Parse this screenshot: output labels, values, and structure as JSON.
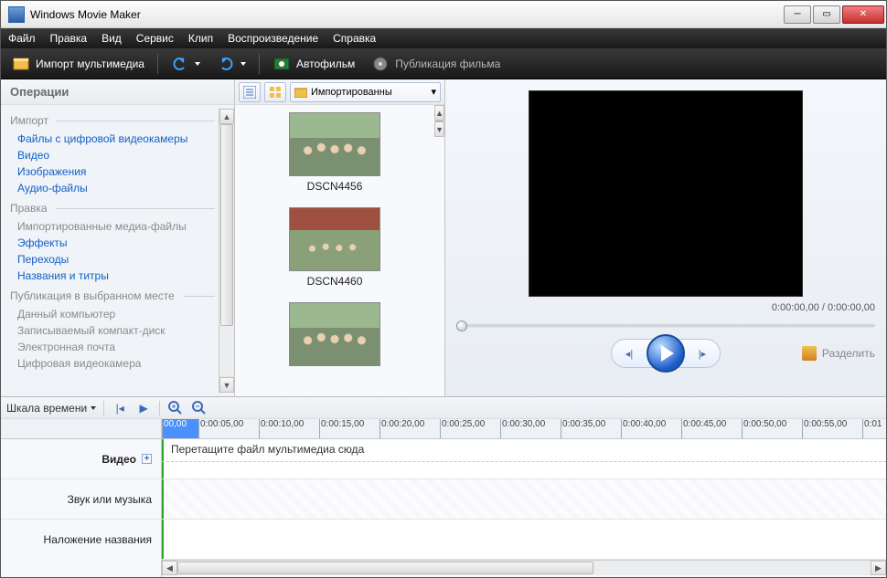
{
  "titlebar": {
    "title": "Windows Movie Maker"
  },
  "menubar": [
    "Файл",
    "Правка",
    "Вид",
    "Сервис",
    "Клип",
    "Воспроизведение",
    "Справка"
  ],
  "toolbar": {
    "import": "Импорт мультимедиа",
    "automovie": "Автофильм",
    "publish": "Публикация фильма"
  },
  "tasks": {
    "header": "Операции",
    "groups": [
      {
        "title": "Импорт",
        "cls": "mid",
        "items": [
          {
            "label": "Файлы с цифровой видеокамеры",
            "enabled": true
          },
          {
            "label": "Видео",
            "enabled": true
          },
          {
            "label": "Изображения",
            "enabled": true
          },
          {
            "label": "Аудио-файлы",
            "enabled": true
          }
        ]
      },
      {
        "title": "Правка",
        "cls": "mid",
        "items": [
          {
            "label": "Импортированные медиа-файлы",
            "enabled": false
          },
          {
            "label": "Эффекты",
            "enabled": true
          },
          {
            "label": "Переходы",
            "enabled": true
          },
          {
            "label": "Названия и титры",
            "enabled": true
          }
        ]
      },
      {
        "title": "Публикация в выбранном месте",
        "cls": "long",
        "items": [
          {
            "label": "Данный компьютер",
            "enabled": false
          },
          {
            "label": "Записываемый компакт-диск",
            "enabled": false
          },
          {
            "label": "Электронная почта",
            "enabled": false
          },
          {
            "label": "Цифровая видеокамера",
            "enabled": false
          }
        ]
      }
    ]
  },
  "collection": {
    "dropdown": "Импортированны",
    "clips": [
      {
        "name": "DSCN4456"
      },
      {
        "name": "DSCN4460"
      },
      {
        "name": ""
      }
    ]
  },
  "preview": {
    "time": "0:00:00,00 / 0:00:00,00",
    "split": "Разделить"
  },
  "timeline": {
    "mode": "Шкала времени",
    "ruler": [
      "00,00",
      "0:00:05,00",
      "0:00:10,00",
      "0:00:15,00",
      "0:00:20,00",
      "0:00:25,00",
      "0:00:30,00",
      "0:00:35,00",
      "0:00:40,00",
      "0:00:45,00",
      "0:00:50,00",
      "0:00:55,00",
      "0:01"
    ],
    "rows": {
      "video": "Видео",
      "audio": "Звук или музыка",
      "title": "Наложение названия"
    },
    "hint": "Перетащите файл мультимедиа сюда"
  }
}
